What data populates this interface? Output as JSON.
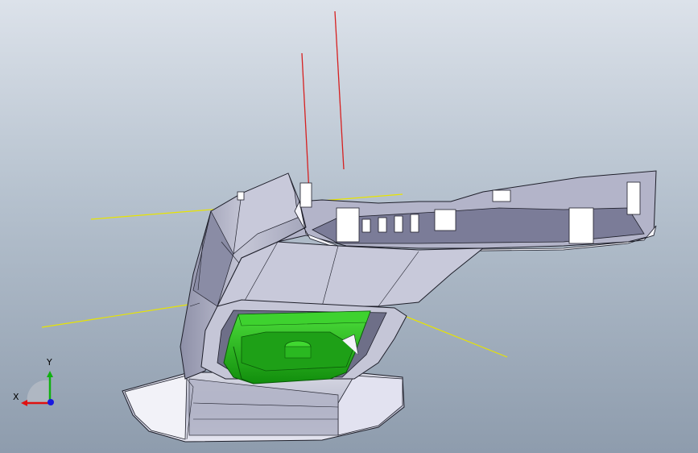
{
  "viewport": {
    "background_top": "#dce2ea",
    "background_bottom": "#8e9cad"
  },
  "model": {
    "body_color": "#c9cbd8",
    "body_shade_color": "#9d9fb4",
    "highlight_color": "#f4f4fa",
    "insert_color": "#22c51a",
    "insert_dark_color": "#108a0c",
    "edge_color": "#1e1f2a"
  },
  "construction": {
    "plane_line_color": "#e8e400",
    "axis_line_color": "#d62020"
  },
  "triad": {
    "x_label": "X",
    "y_label": "Y",
    "x_color": "#e01010",
    "y_color": "#10b010",
    "z_color": "#1818e0",
    "icon": "coordinate-triad-icon"
  }
}
